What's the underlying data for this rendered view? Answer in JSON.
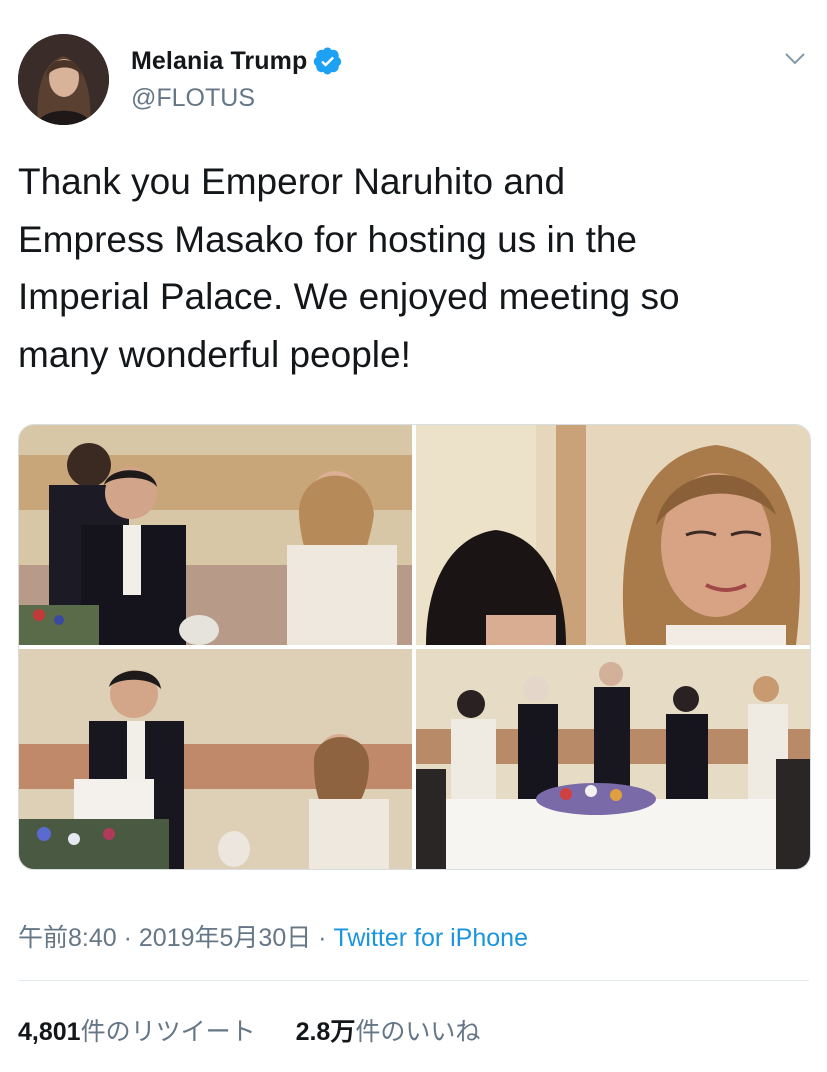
{
  "user": {
    "name": "Melania Trump",
    "handle": "@FLOTUS",
    "verified": true,
    "avatar_icon": "profile-avatar"
  },
  "tweet": {
    "text": "Thank you Emperor Naruhito and\nEmpress Masako for hosting us in the\nImperial Palace. We enjoyed meeting so\nmany wonderful people!",
    "media_count": 4,
    "time": "午前8:40",
    "date": "2019年5月30日",
    "separator": " · ",
    "source": "Twitter for iPhone"
  },
  "stats": {
    "retweets_value": "4,801",
    "retweets_label": "件のリツイート",
    "likes_value": "2.8万",
    "likes_label": "件のいいね"
  },
  "colors": {
    "text": "#14171a",
    "secondary": "#657786",
    "link": "#1b95e0",
    "verified": "#1da1f2",
    "divider": "#e1e8ed"
  },
  "icons": {
    "verified": "verified-badge-icon",
    "menu": "chevron-down-icon"
  }
}
